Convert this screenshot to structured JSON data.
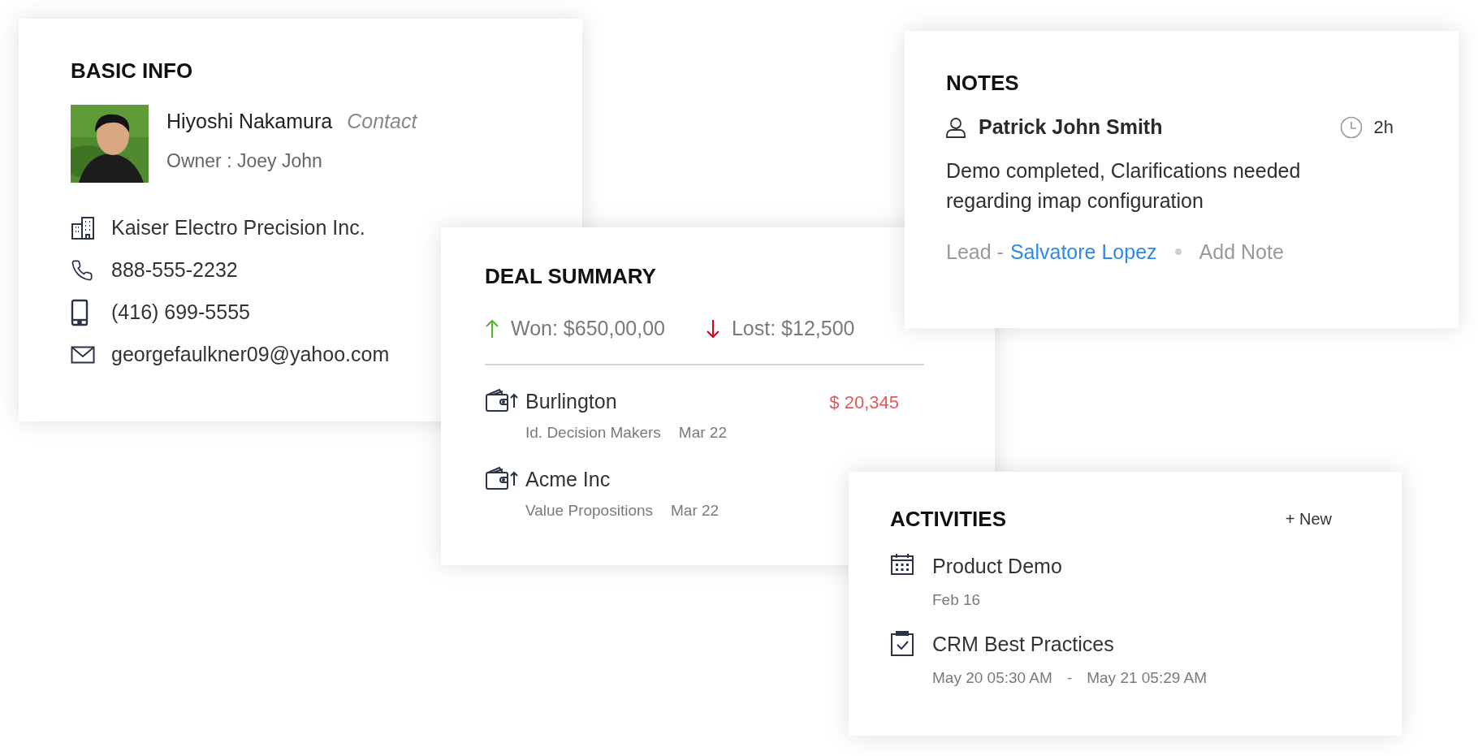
{
  "basic_info": {
    "title": "BASIC INFO",
    "name": "Hiyoshi Nakamura",
    "role": "Contact",
    "owner": "Owner : Joey John",
    "details": [
      {
        "kind": "company",
        "text": "Kaiser Electro Precision Inc."
      },
      {
        "kind": "phone",
        "text": "888-555-2232"
      },
      {
        "kind": "mobile",
        "text": "(416) 699-5555"
      },
      {
        "kind": "email",
        "text": "georgefaulkner09@yahoo.com"
      }
    ]
  },
  "deal_summary": {
    "title": "DEAL SUMMARY",
    "totals": [
      {
        "kind": "won",
        "text": "Won: $650,00,00"
      },
      {
        "kind": "lost",
        "text": "Lost: $12,500"
      }
    ],
    "deals": [
      {
        "name": "Burlington",
        "amount": "$ 20,345",
        "stage": "Id. Decision Makers",
        "date": "Mar 22"
      },
      {
        "name": "Acme Inc",
        "stage": "Value Propositions",
        "date": "Mar 22"
      }
    ]
  },
  "notes": {
    "title": "NOTES",
    "author": "Patrick John Smith",
    "time": "2h",
    "text": "Demo completed, Clarifications needed regarding imap configuration",
    "lead_label": "Lead -",
    "lead_name": "Salvatore Lopez",
    "add_note": "Add Note"
  },
  "activities": {
    "title": "ACTIVITIES",
    "new_button": "+ New",
    "items": [
      {
        "kind": "event",
        "title": "Product Demo",
        "dates": [
          "Feb 16"
        ]
      },
      {
        "kind": "task",
        "title": "CRM Best Practices",
        "dates": [
          "May 20 05:30 AM",
          "-",
          "May 21 05:29 AM"
        ]
      }
    ]
  }
}
